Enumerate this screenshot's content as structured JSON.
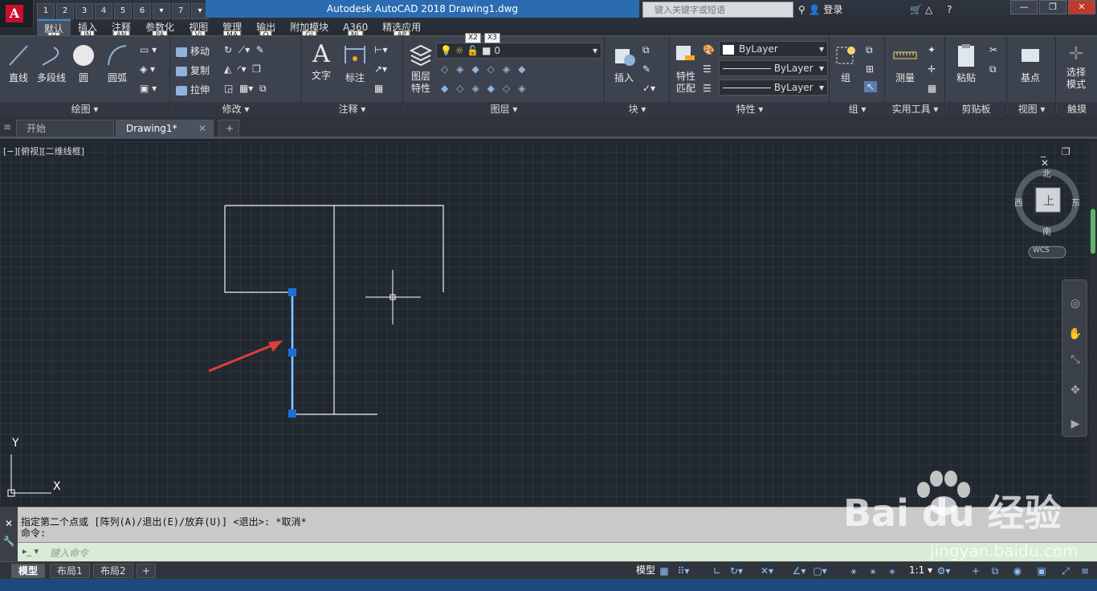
{
  "titlebar": {
    "logo_letter": "A",
    "qat": [
      "1",
      "2",
      "3",
      "4",
      "5",
      "6",
      "▾",
      "7",
      "▾"
    ],
    "title": "Autodesk AutoCAD 2018    Drawing1.dwg",
    "search_placeholder": "键入关键字或短语",
    "login": "登录"
  },
  "ribbon_tabs": [
    {
      "label": "默认",
      "key": "H"
    },
    {
      "label": "插入",
      "key": "IN"
    },
    {
      "label": "注释",
      "key": "AN"
    },
    {
      "label": "参数化",
      "key": "PA"
    },
    {
      "label": "视图",
      "key": "VI"
    },
    {
      "label": "管理",
      "key": "MA"
    },
    {
      "label": "输出",
      "key": "O"
    },
    {
      "label": "附加模块",
      "key": "GI"
    },
    {
      "label": "A360",
      "key": "NL"
    },
    {
      "label": "精选应用",
      "key": "AP"
    }
  ],
  "ribbon": {
    "draw": {
      "title": "绘图 ▾",
      "line": "直线",
      "polyline": "多段线",
      "circle": "圆",
      "arc": "圆弧"
    },
    "modify": {
      "title": "修改 ▾",
      "move": "移动",
      "copy": "复制",
      "stretch": "拉伸"
    },
    "annotation": {
      "title": "注释 ▾",
      "text": "文字",
      "dimension": "标注"
    },
    "layers": {
      "title": "图层 ▾",
      "layer_props": "图层\n特性",
      "current_layer": "0",
      "keys": [
        "X2",
        "X3"
      ]
    },
    "block": {
      "title": "块 ▾",
      "insert": "插入"
    },
    "properties": {
      "title": "特性 ▾",
      "match": "特性\n匹配",
      "color": "ByLayer",
      "linetype": "ByLayer",
      "lineweight": "ByLayer"
    },
    "groups": {
      "title": "组 ▾",
      "group": "组"
    },
    "utilities": {
      "title": "实用工具 ▾",
      "measure": "测量"
    },
    "clipboard": {
      "title": "剪贴板",
      "paste": "粘贴"
    },
    "view": {
      "title": "视图 ▾",
      "base": "基点"
    },
    "touch": {
      "title": "触摸",
      "select_mode": "选择\n模式"
    }
  },
  "doc_tabs": [
    {
      "label": "开始"
    },
    {
      "label": "Drawing1*"
    }
  ],
  "viewport": {
    "label": "[−][俯视][二维线框]",
    "controls": "_ ❐ ✕"
  },
  "viewcube": {
    "north": "北",
    "south": "南",
    "east": "东",
    "west": "西",
    "top": "上",
    "wcs": "WCS"
  },
  "ucs": {
    "x": "X",
    "y": "Y"
  },
  "command": {
    "line1": "指定第二个点或 [阵列(A)/退出(E)/放弃(U)] <退出>: *取消*",
    "line2": "命令:",
    "input_placeholder": "键入命令"
  },
  "status": {
    "layouts": [
      "模型",
      "布局1",
      "布局2"
    ],
    "model_btn": "模型",
    "scale": "1:1"
  },
  "watermark": {
    "brand": "Bai du 经验",
    "url": "jingyan.baidu.com"
  },
  "colors": {
    "accent": "#2b6cb0",
    "selection": "#1e6fd9",
    "canvas": "#212830",
    "arrow": "#e23b3b"
  }
}
